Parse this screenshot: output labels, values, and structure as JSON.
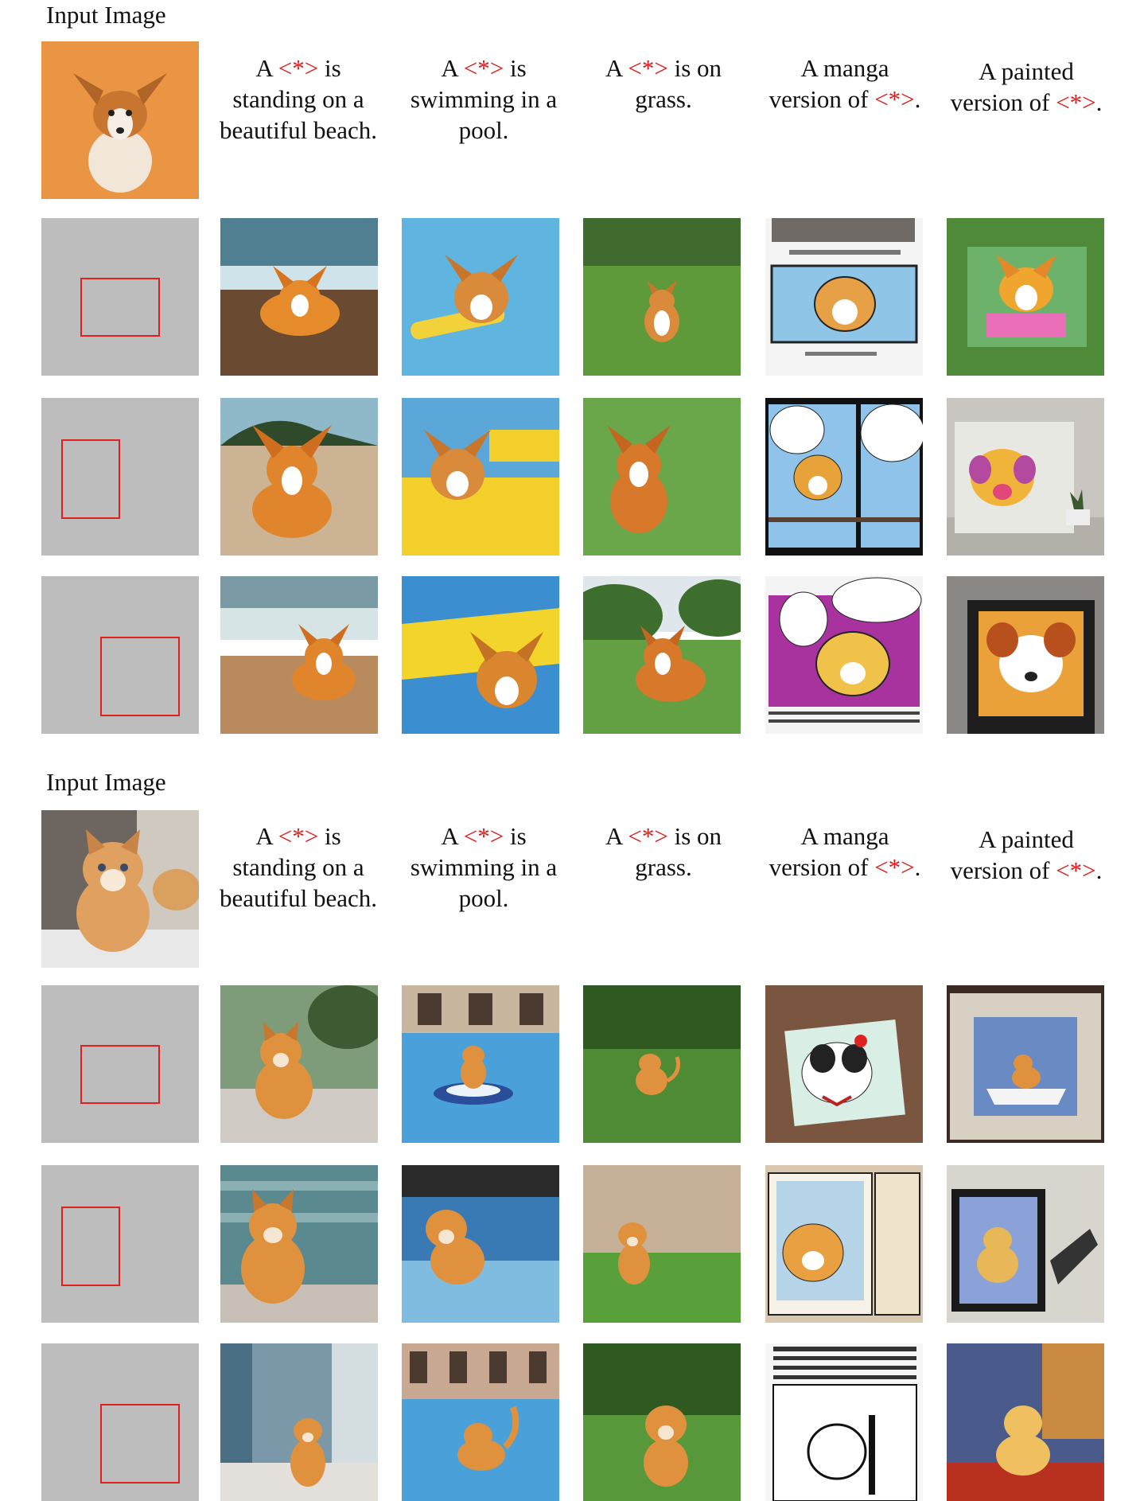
{
  "sections": [
    {
      "input_label": "Input Image",
      "input_subject": "corgi",
      "prompts": [
        {
          "pre": "A ",
          "token": "<*>",
          "post": " is standing on a beautiful beach."
        },
        {
          "pre": "A ",
          "token": "<*>",
          "post": " is swimming in a pool."
        },
        {
          "pre": "A ",
          "token": "<*>",
          "post": " is on grass."
        },
        {
          "pre": "A manga version of ",
          "token": "<*>",
          "post": "."
        },
        {
          "pre": "A painted version of ",
          "token": "<*>",
          "post": "."
        }
      ]
    },
    {
      "input_label": "Input Image",
      "input_subject": "kitten",
      "prompts": [
        {
          "pre": "A ",
          "token": "<*>",
          "post": " is standing on a beautiful beach."
        },
        {
          "pre": "A ",
          "token": "<*>",
          "post": " is swimming in a pool."
        },
        {
          "pre": "A ",
          "token": "<*>",
          "post": " is on grass."
        },
        {
          "pre": "A manga version of ",
          "token": "<*>",
          "post": "."
        },
        {
          "pre": "A painted version of ",
          "token": "<*>",
          "post": "."
        }
      ]
    }
  ],
  "colors": {
    "token": "#e01a1a",
    "mask_background": "#bdbdbd",
    "mask_box": "#e02020"
  }
}
